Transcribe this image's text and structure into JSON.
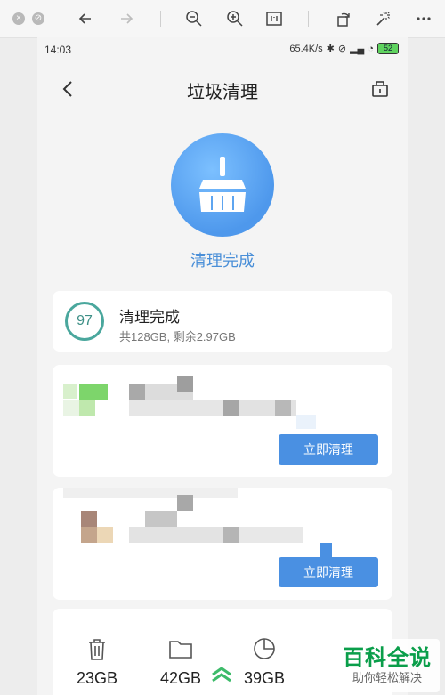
{
  "viewer": {
    "close_icon": "close-icon",
    "minimize_icon": "minimize-icon",
    "icons": [
      "back-arrow-icon",
      "forward-arrow-icon",
      "zoom-out-icon",
      "zoom-in-icon",
      "actual-size-icon",
      "rotate-icon",
      "magic-wand-icon",
      "more-icon"
    ]
  },
  "status": {
    "time": "14:03",
    "speed": "65.4K/s",
    "battery": "52"
  },
  "nav": {
    "title": "垃圾清理"
  },
  "hero": {
    "label": "清理完成"
  },
  "summary": {
    "score": "97",
    "heading": "清理完成",
    "detail": "共128GB, 剩余2.97GB"
  },
  "items": [
    {
      "button": "立即清理"
    },
    {
      "button": "立即清理"
    }
  ],
  "stats": [
    {
      "icon": "trash-icon",
      "value": "23GB"
    },
    {
      "icon": "folder-icon",
      "value": "42GB"
    },
    {
      "icon": "pie-chart-icon",
      "value": "39GB"
    }
  ],
  "watermark": {
    "main": "百科全说",
    "sub": "助你轻松解决"
  },
  "colors": {
    "accent": "#4a90e2",
    "score_ring": "#4aa79d",
    "watermark": "#0a9e4a"
  }
}
